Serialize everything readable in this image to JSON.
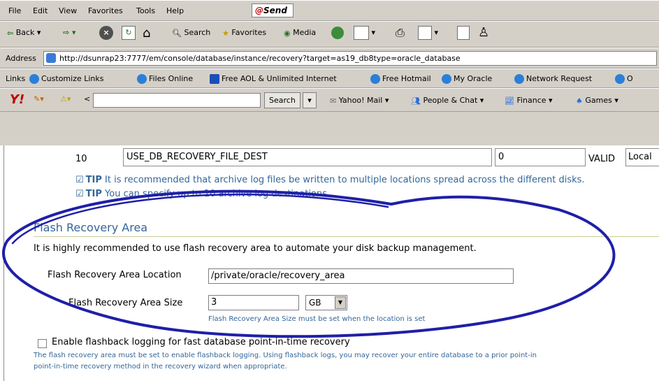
{
  "menu": [
    "File",
    "Edit",
    "View",
    "Favorites",
    "Tools",
    "Help"
  ],
  "send_label": "Send",
  "toolbar": {
    "back": "Back",
    "search": "Search",
    "favorites": "Favorites",
    "media": "Media"
  },
  "address": {
    "label": "Address",
    "url": "http://dsunrap23:7777/em/console/database/instance/recovery?target=as19_db8type=oracle_database"
  },
  "links": {
    "label": "Links",
    "items": [
      "Customize Links",
      "Files Online",
      "Free AOL & Unlimited Internet",
      "Free Hotmail",
      "My Oracle",
      "Network Request",
      "O"
    ]
  },
  "yahoo": {
    "search_button": "Search",
    "items": [
      "Yahoo! Mail",
      "People & Chat",
      "Finance",
      "Games"
    ]
  },
  "dest_row": {
    "number": "10",
    "destination": "USE_DB_RECOVERY_FILE_DEST",
    "quota": "0",
    "status": "VALID",
    "type": "Local"
  },
  "tips": [
    {
      "label": "TIP",
      "text": "It is recommended that archive log files be written to multiple locations spread across the different disks."
    },
    {
      "label": "TIP",
      "text": "You can specify up to 10 archive log destinations."
    }
  ],
  "flash": {
    "title": "Flash Recovery Area",
    "intro": "It is highly recommended to use flash recovery area to automate your disk backup management.",
    "location_label": "Flash Recovery Area Location",
    "location_value": "/private/oracle/recovery_area",
    "size_label": "Flash Recovery Area Size",
    "size_value": "3",
    "size_unit": "GB",
    "size_hint": "Flash Recovery Area Size must be set when the location is set",
    "flashback_label": "Enable flashback logging for fast database point-in-time recovery",
    "note_line1": "The flash recovery area must be set to enable flashback logging. Using flashback logs, you may recover your entire database to a prior point-in",
    "note_line2": "point-in-time recovery method in the recovery wizard when appropriate."
  },
  "colors": {
    "link_blue": "#336699",
    "annotation": "#1f1fa8"
  }
}
